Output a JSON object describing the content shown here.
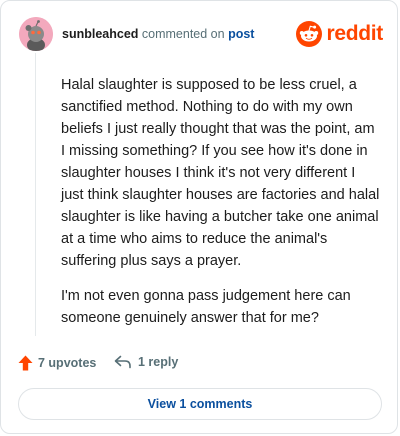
{
  "header": {
    "username": "sunbleahced",
    "action_text": " commented on ",
    "post_link": "post",
    "logo_text": "reddit",
    "avatar_icon": "snoo-avatar-icon",
    "logo_icon": "reddit-alien-icon"
  },
  "comment": {
    "paragraphs": [
      "Halal slaughter is supposed to be less cruel, a sanctified method. Nothing to do with my own beliefs I just really thought that was the point, am I missing something? If you see how it's done in slaughter houses I think it's not very different I just think slaughter houses are factories and halal slaughter is like having a butcher take one animal at a time who aims to reduce the animal's suffering plus says a prayer.",
      "I'm not even gonna pass judgement here can someone genuinely answer that for me?"
    ]
  },
  "actions": {
    "upvotes_label": "7 upvotes",
    "reply_label": "1 reply",
    "upvote_icon": "upvote-arrow-icon",
    "reply_icon": "reply-arrow-icon"
  },
  "footer": {
    "view_comments_label": "View 1 comments"
  },
  "colors": {
    "brand": "#ff4500",
    "link": "#0a4f9e",
    "muted": "#576f76",
    "avatar_bg": "#f3a9bd"
  }
}
